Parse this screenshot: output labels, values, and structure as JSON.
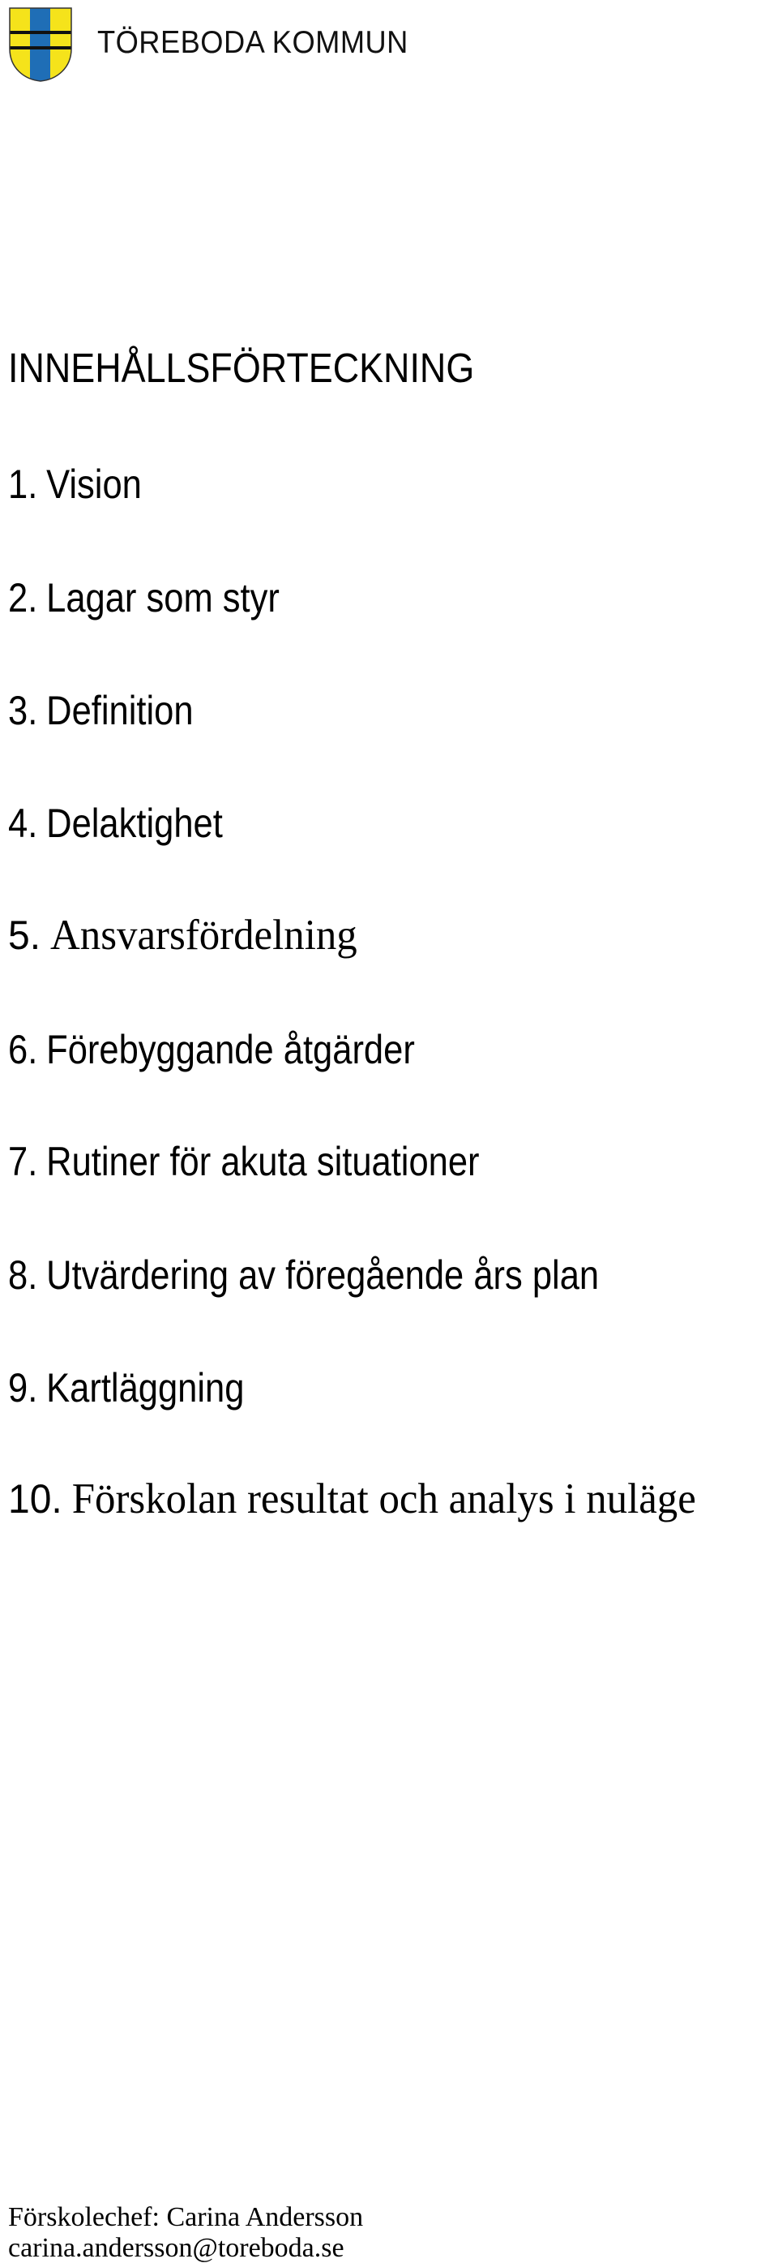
{
  "header": {
    "logo": {
      "icon": "coat-of-arms-shield",
      "text": "TÖREBODA KOMMUN",
      "colors": {
        "yellow": "#F5E31B",
        "blue": "#1F6EB6",
        "stripe": "#111111"
      }
    }
  },
  "toc": {
    "heading": "INNEHÅLLSFÖRTECKNING",
    "items": [
      {
        "number": "1.",
        "title": "Vision"
      },
      {
        "number": "2.",
        "title": "Lagar som styr"
      },
      {
        "number": "3.",
        "title": "Definition"
      },
      {
        "number": "4.",
        "title": "Delaktighet"
      },
      {
        "number": "5.",
        "title": "Ansvarsfördelning"
      },
      {
        "number": "6.",
        "title": "Förebyggande åtgärder"
      },
      {
        "number": "7.",
        "title": "Rutiner för akuta situationer"
      },
      {
        "number": "8.",
        "title": "Utvärdering av föregående års plan"
      },
      {
        "number": "9.",
        "title": "Kartläggning"
      },
      {
        "number": "10.",
        "title": "Förskolan resultat och analys i nuläge"
      }
    ]
  },
  "footer": {
    "contact_line": "Förskolechef: Carina Andersson",
    "email": "carina.andersson@toreboda.se"
  }
}
